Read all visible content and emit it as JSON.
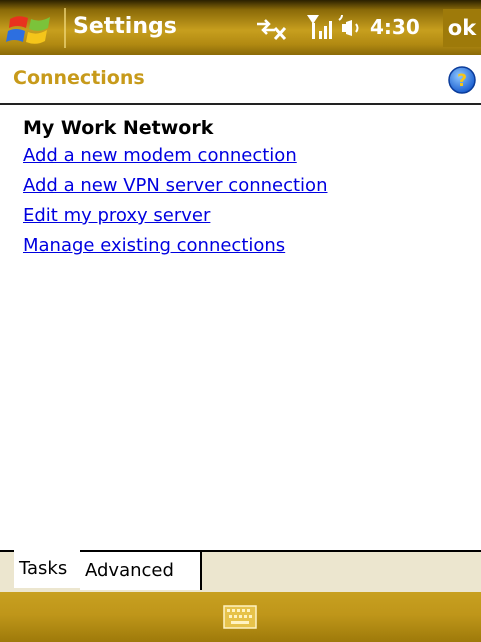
{
  "titlebar": {
    "app_title": "Settings",
    "clock": "4:30",
    "ok_label": "ok",
    "icons": [
      "windows-start-icon",
      "connectivity-icon",
      "signal-strength-icon",
      "volume-icon"
    ]
  },
  "header": {
    "title": "Connections",
    "help_icon": "help-icon"
  },
  "section": {
    "title": "My Work Network",
    "links": [
      "Add a new modem connection",
      "Add a new VPN server connection",
      "Edit my proxy server",
      "Manage existing connections"
    ]
  },
  "tabs": [
    {
      "label": "Tasks",
      "selected": true
    },
    {
      "label": "Advanced",
      "selected": false
    }
  ],
  "bottombar": {
    "keyboard_icon": "keyboard-icon"
  },
  "colors": {
    "accent": "#c79a1a",
    "link": "#0000e0",
    "bar": "#b8900f"
  }
}
